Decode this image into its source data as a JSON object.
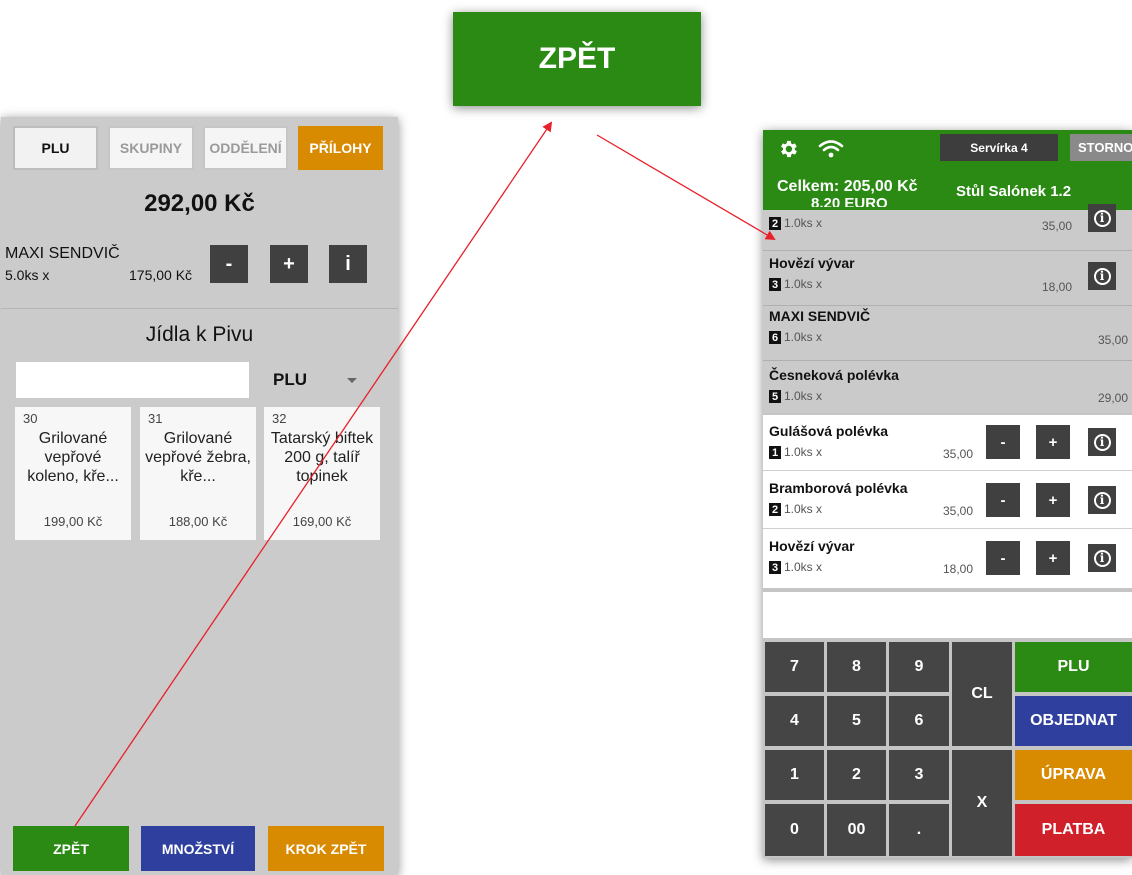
{
  "callout": {
    "label": "ZPĚT"
  },
  "left": {
    "tabs": [
      "PLU",
      "SKUPINY",
      "ODDĚLENÍ",
      "PŘÍLOHY"
    ],
    "total": "292,00 Kč",
    "current_item": {
      "name": "MAXI SENDVIČ",
      "qty": "5.0ks x",
      "price": "175,00 Kč"
    },
    "item_buttons": {
      "minus": "-",
      "plus": "+",
      "info": "i"
    },
    "group_title": "Jídla k Pivu",
    "search": {
      "value": "",
      "mode": "PLU"
    },
    "products": [
      {
        "num": "30",
        "name": "Grilované vepřové koleno, kře...",
        "price": "199,00 Kč"
      },
      {
        "num": "31",
        "name": "Grilované vepřové žebra, kře...",
        "price": "188,00 Kč"
      },
      {
        "num": "32",
        "name": "Tatarský biftek 200 g, talíř topinek",
        "price": "169,00 Kč"
      }
    ],
    "bottom_buttons": [
      "ZPĚT",
      "MNOŽSTVÍ",
      "KROK ZPĚT"
    ]
  },
  "right": {
    "waiter": "Servírka 4",
    "storno": "STORNO",
    "total": "Celkem: 205,00 Kč",
    "total_euro": "8,20 EURO",
    "table": "Stůl Salónek 1.2",
    "items": [
      {
        "badge": "2",
        "name": "",
        "qty": "1.0ks x",
        "price": "35,00"
      },
      {
        "badge": "3",
        "name": "Hovězí vývar",
        "qty": "1.0ks x",
        "price": "18,00"
      },
      {
        "badge": "6",
        "name": "MAXI SENDVIČ",
        "qty": "1.0ks x",
        "price": "35,00"
      },
      {
        "badge": "5",
        "name": "Česneková polévka",
        "qty": "1.0ks x",
        "price": "29,00"
      },
      {
        "badge": "1",
        "name": "Gulášová polévka",
        "qty": "1.0ks x",
        "price": "35,00"
      },
      {
        "badge": "2",
        "name": "Bramborová polévka",
        "qty": "1.0ks x",
        "price": "35,00"
      },
      {
        "badge": "3",
        "name": "Hovězí vývar",
        "qty": "1.0ks x",
        "price": "18,00"
      }
    ],
    "info_glyph": "i",
    "minus": "-",
    "plus": "+",
    "keypad": [
      "7",
      "8",
      "9",
      "4",
      "5",
      "6",
      "1",
      "2",
      "3",
      "0",
      "00",
      "."
    ],
    "cl": "CL",
    "x": "X",
    "actions": [
      "PLU",
      "OBJEDNAT",
      "ÚPRAVA",
      "PLATBA"
    ]
  },
  "colors": {
    "green": "#2a8a13",
    "orange": "#d88a00",
    "blue": "#2f3f9e",
    "red": "#d0202a",
    "dark_key": "#454545",
    "arrow": "#e8202a"
  }
}
